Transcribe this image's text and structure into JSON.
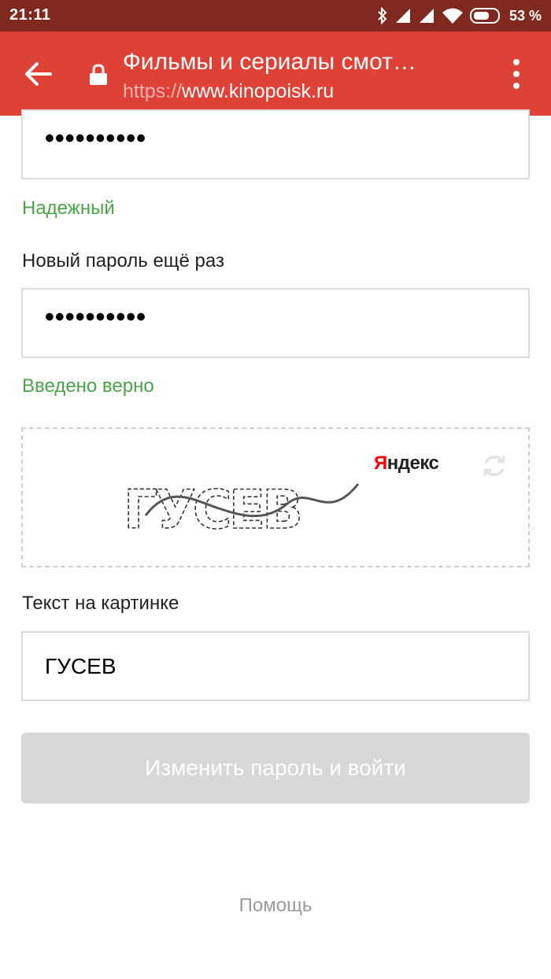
{
  "status_bar": {
    "time": "21:11",
    "battery_percent": "53 %",
    "icons": [
      "bluetooth-icon",
      "signal-icon",
      "signal-icon",
      "wifi-icon",
      "battery-icon"
    ]
  },
  "browser": {
    "title": "Фильмы и сериалы смот…",
    "url_scheme": "https://",
    "url_host": "www.kinopoisk.ru",
    "back_icon": "back-arrow-icon",
    "lock_icon": "lock-icon",
    "menu_icon": "more-vert-icon"
  },
  "form": {
    "new_password": {
      "value": "••••••••••",
      "strength_text": "Надежный"
    },
    "confirm_password": {
      "label": "Новый пароль ещё раз",
      "value": "••••••••••",
      "status_text": "Введено верно"
    },
    "captcha": {
      "text": "ГУСЕВ",
      "provider_logo": "Яндекс",
      "provider_logo_first": "Я",
      "provider_logo_rest": "ндекс",
      "refresh_icon": "refresh-icon"
    },
    "captcha_input": {
      "label": "Текст на картинке",
      "value": "ГУСЕВ"
    },
    "submit_label": "Изменить пароль и войти"
  },
  "help_link": "Помощь",
  "colors": {
    "status_bar": "#80291f",
    "app_bar": "#de4136",
    "success_green": "#4ba34a",
    "disabled_button": "#d8d8d8"
  }
}
